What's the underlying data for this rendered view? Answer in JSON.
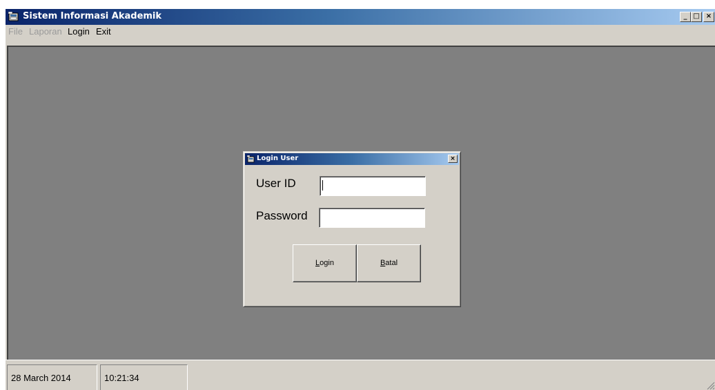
{
  "window": {
    "title": "Sistem Informasi Akademik",
    "icon": "app-icon",
    "buttons": {
      "minimize": "_",
      "maximize": "□",
      "close": "×"
    }
  },
  "menu": {
    "items": [
      {
        "label": "File",
        "enabled": false
      },
      {
        "label": "Laporan",
        "enabled": false
      },
      {
        "label": "Login",
        "enabled": true
      },
      {
        "label": "Exit",
        "enabled": true
      }
    ]
  },
  "dialog": {
    "title": "Login User",
    "close": "×",
    "userid_label": "User ID",
    "userid_value": "",
    "password_label": "Password",
    "password_value": "",
    "login_button": {
      "accel": "L",
      "rest": "ogin"
    },
    "cancel_button": {
      "accel": "B",
      "rest": "atal"
    }
  },
  "status": {
    "date": "28 March 2014",
    "time": "10:21:34"
  },
  "colors": {
    "titlebar_start": "#0a246a",
    "titlebar_end": "#a6caf0",
    "face": "#d4d0c8",
    "mdi_background": "#808080"
  }
}
